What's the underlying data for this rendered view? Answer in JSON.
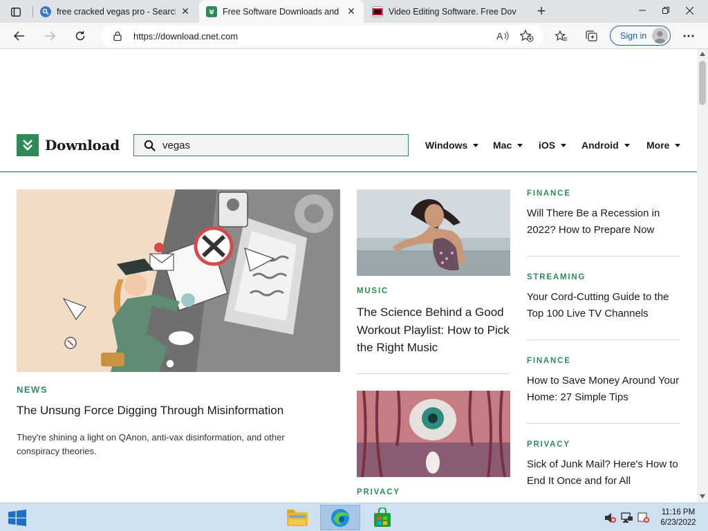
{
  "browser": {
    "tabs": [
      {
        "title": "free cracked vegas pro - Search",
        "favicon": "search-favicon"
      },
      {
        "title": "Free Software Downloads and Re",
        "favicon": "download-favicon"
      },
      {
        "title": "Video Editing Software. Free Dov",
        "favicon": "nch-favicon"
      }
    ],
    "close_symbol": "✕",
    "new_tab_symbol": "+",
    "address": "https://download.cnet.com",
    "sign_in": "Sign in"
  },
  "site": {
    "logo_text": "Download",
    "search_value": "vegas",
    "nav": [
      {
        "label": "Windows"
      },
      {
        "label": "Mac"
      },
      {
        "label": "iOS"
      },
      {
        "label": "Android"
      },
      {
        "label": "More"
      }
    ]
  },
  "main_story": {
    "kicker": "NEWS",
    "headline": "The Unsung Force Digging Through Misinformation",
    "dek": "They're shining a light on QAnon, anti-vax disinformation, and other conspiracy theories."
  },
  "middle_stories": [
    {
      "kicker": "MUSIC",
      "headline": "The Science Behind a Good Workout Playlist: How to Pick the Right Music"
    },
    {
      "kicker": "PRIVACY",
      "headline": ""
    }
  ],
  "side_stories": [
    {
      "kicker": "FINANCE",
      "headline": "Will There Be a Recession in 2022? How to Prepare Now"
    },
    {
      "kicker": "STREAMING",
      "headline": "Your Cord-Cutting Guide to the Top 100 Live TV Channels"
    },
    {
      "kicker": "FINANCE",
      "headline": "How to Save Money Around Your Home: 27 Simple Tips"
    },
    {
      "kicker": "PRIVACY",
      "headline": "Sick of Junk Mail? Here's How to End It Once and for All"
    }
  ],
  "taskbar": {
    "time": "11:16 PM",
    "date": "6/23/2022"
  },
  "colors": {
    "brand_green": "#2f8a57",
    "tab_strip": "#dfe3e8",
    "taskbar": "#cfe0f1"
  }
}
